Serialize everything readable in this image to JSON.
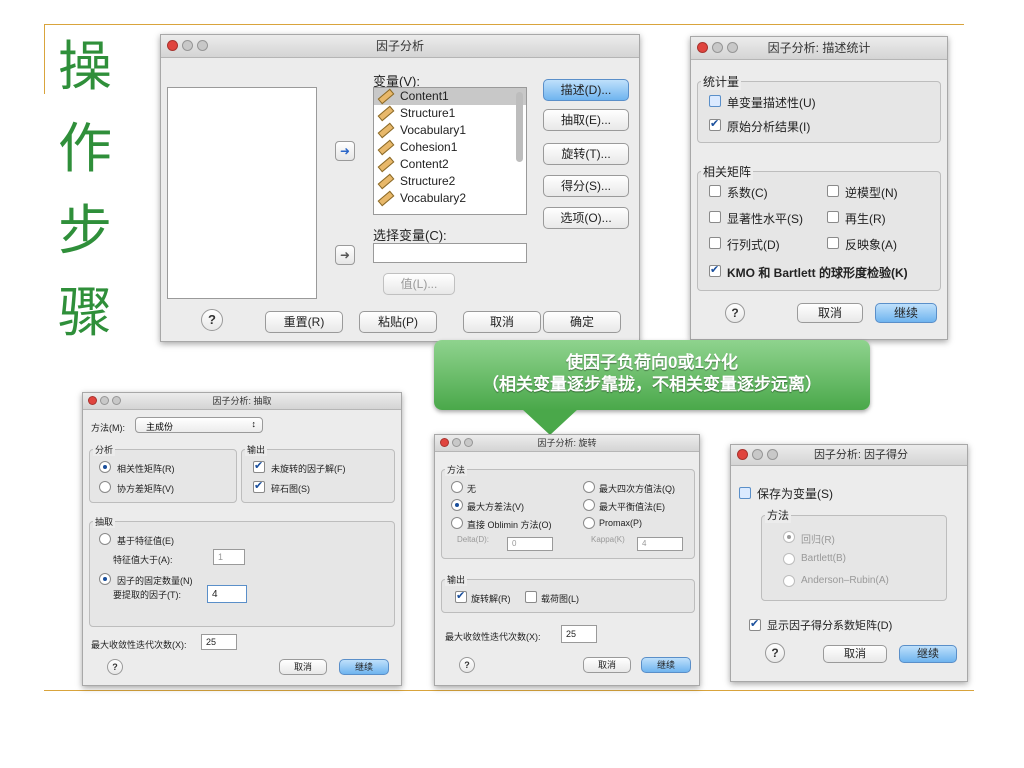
{
  "slide": {
    "title_chars": [
      "操",
      "作",
      "步",
      "骤"
    ],
    "accent_color": "#d9a43c",
    "title_color": "#2f8f3a"
  },
  "callout": {
    "line1": "使因子负荷向0或1分化",
    "line2": "（相关变量逐步靠拢，不相关变量逐步远离）"
  },
  "main_dialog": {
    "title": "因子分析",
    "variables_label": "变量(V):",
    "variables": [
      "Content1",
      "Structure1",
      "Vocabulary1",
      "Cohesion1",
      "Content2",
      "Structure2",
      "Vocabulary2"
    ],
    "selection_label": "选择变量(C):",
    "value_button": "值(L)...",
    "side_buttons": [
      "描述(D)...",
      "抽取(E)...",
      "旋转(T)...",
      "得分(S)...",
      "选项(O)..."
    ],
    "bottom_buttons": [
      "重置(R)",
      "粘贴(P)",
      "取消",
      "确定"
    ],
    "help": "?"
  },
  "desc_dialog": {
    "title": "因子分析: 描述统计",
    "stats_group": "统计量",
    "stats": [
      {
        "label": "单变量描述性(U)",
        "checked": false
      },
      {
        "label": "原始分析结果(I)",
        "checked": true
      }
    ],
    "matrix_group": "相关矩阵",
    "matrix": [
      {
        "label": "系数(C)",
        "checked": false
      },
      {
        "label": "逆模型(N)",
        "checked": false
      },
      {
        "label": "显著性水平(S)",
        "checked": false
      },
      {
        "label": "再生(R)",
        "checked": false
      },
      {
        "label": "行列式(D)",
        "checked": false
      },
      {
        "label": "反映象(A)",
        "checked": false
      },
      {
        "label": "KMO 和 Bartlett 的球形度检验(K)",
        "checked": true
      }
    ],
    "cancel": "取消",
    "continue": "继续",
    "help": "?"
  },
  "extract_dialog": {
    "title": "因子分析: 抽取",
    "method_label": "方法(M):",
    "method_value": "主成份",
    "analysis_group": "分析",
    "analysis": [
      {
        "label": "相关性矩阵(R)",
        "selected": true
      },
      {
        "label": "协方差矩阵(V)",
        "selected": false
      }
    ],
    "output_group": "输出",
    "output": [
      {
        "label": "未旋转的因子解(F)",
        "checked": true
      },
      {
        "label": "碎石图(S)",
        "checked": true
      }
    ],
    "extract_group": "抽取",
    "eigen_option": "基于特征值(E)",
    "eigen_label": "特征值大于(A):",
    "eigen_value": "1",
    "fixed_option": "因子的固定数量(N)",
    "fixed_label": "要提取的因子(T):",
    "fixed_value": "4",
    "iter_label": "最大收敛性迭代次数(X):",
    "iter_value": "25",
    "cancel": "取消",
    "continue": "继续",
    "help": "?"
  },
  "rotate_dialog": {
    "title": "因子分析: 旋转",
    "method_group": "方法",
    "methods": [
      {
        "label": "无",
        "selected": false
      },
      {
        "label": "最大四次方值法(Q)",
        "selected": false
      },
      {
        "label": "最大方差法(V)",
        "selected": true
      },
      {
        "label": "最大平衡值法(E)",
        "selected": false
      },
      {
        "label": "直接 Oblimin 方法(O)",
        "selected": false
      },
      {
        "label": "Promax(P)",
        "selected": false
      }
    ],
    "delta_label": "Delta(D):",
    "delta_value": "0",
    "kappa_label": "Kappa(K)",
    "kappa_value": "4",
    "output_group": "输出",
    "output": [
      {
        "label": "旋转解(R)",
        "checked": true
      },
      {
        "label": "载荷图(L)",
        "checked": false
      }
    ],
    "iter_label": "最大收敛性迭代次数(X):",
    "iter_value": "25",
    "cancel": "取消",
    "continue": "继续",
    "help": "?"
  },
  "score_dialog": {
    "title": "因子分析: 因子得分",
    "save_label": "保存为变量(S)",
    "save_checked": false,
    "method_group": "方法",
    "methods": [
      "回归(R)",
      "Bartlett(B)",
      "Anderson–Rubin(A)"
    ],
    "display_label": "显示因子得分系数矩阵(D)",
    "display_checked": true,
    "cancel": "取消",
    "continue": "继续",
    "help": "?"
  }
}
